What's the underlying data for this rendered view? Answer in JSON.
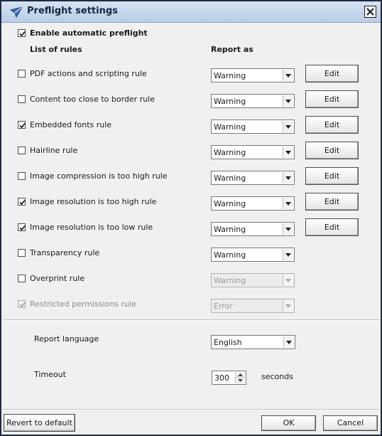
{
  "window": {
    "title": "Preflight settings",
    "icon": "paper-plane-icon",
    "close": "close-icon"
  },
  "enable": {
    "label": "Enable automatic preflight",
    "checked": true
  },
  "headers": {
    "rules": "List of rules",
    "report": "Report as"
  },
  "edit_label": "Edit",
  "rules": [
    {
      "label": "PDF actions and scripting rule",
      "checked": false,
      "report": "Warning",
      "editable": true,
      "enabled": true
    },
    {
      "label": "Content too close to border rule",
      "checked": false,
      "report": "Warning",
      "editable": true,
      "enabled": true
    },
    {
      "label": "Embedded fonts rule",
      "checked": true,
      "report": "Warning",
      "editable": true,
      "enabled": true
    },
    {
      "label": "Hairline rule",
      "checked": false,
      "report": "Warning",
      "editable": true,
      "enabled": true
    },
    {
      "label": "Image compression is too high rule",
      "checked": false,
      "report": "Warning",
      "editable": true,
      "enabled": true
    },
    {
      "label": "Image resolution is too high rule",
      "checked": true,
      "report": "Warning",
      "editable": true,
      "enabled": true
    },
    {
      "label": "Image resolution is too low rule",
      "checked": true,
      "report": "Warning",
      "editable": true,
      "enabled": true
    },
    {
      "label": "Transparency rule",
      "checked": false,
      "report": "Warning",
      "editable": false,
      "enabled": true
    },
    {
      "label": "Overprint rule",
      "checked": false,
      "report": "Warning",
      "editable": false,
      "enabled": true,
      "select_disabled": true
    },
    {
      "label": "Restricted permissions rule",
      "checked": true,
      "report": "Error",
      "editable": false,
      "enabled": false,
      "select_disabled": true
    }
  ],
  "language": {
    "label": "Report language",
    "value": "English"
  },
  "timeout": {
    "label": "Timeout",
    "value": "300",
    "unit": "seconds"
  },
  "footer": {
    "revert": "Revert to default",
    "ok": "OK",
    "cancel": "Cancel"
  }
}
